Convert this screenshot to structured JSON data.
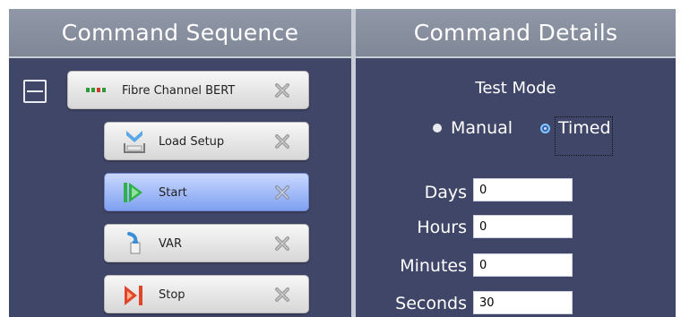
{
  "left_pane": {
    "title": "Command Sequence",
    "commands": [
      {
        "label": "Fibre Channel BERT",
        "icon": "fibre-dots-icon"
      },
      {
        "label": "Load Setup",
        "icon": "load-setup-icon"
      },
      {
        "label": "Start",
        "icon": "play-icon",
        "selected": true
      },
      {
        "label": "VAR",
        "icon": "var-icon"
      },
      {
        "label": "Stop",
        "icon": "stop-icon"
      }
    ]
  },
  "right_pane": {
    "title": "Command Details",
    "test_mode": {
      "label": "Test Mode",
      "options": [
        "Manual",
        "Timed"
      ],
      "selected": "Timed"
    },
    "fields": {
      "days": {
        "label": "Days",
        "value": "0"
      },
      "hours": {
        "label": "Hours",
        "value": "0"
      },
      "minutes": {
        "label": "Minutes",
        "value": "0"
      },
      "seconds": {
        "label": "Seconds",
        "value": "30"
      }
    }
  },
  "colors": {
    "panel": "#404668",
    "header": "#868d9d",
    "selected_item": "#9db5f7"
  }
}
